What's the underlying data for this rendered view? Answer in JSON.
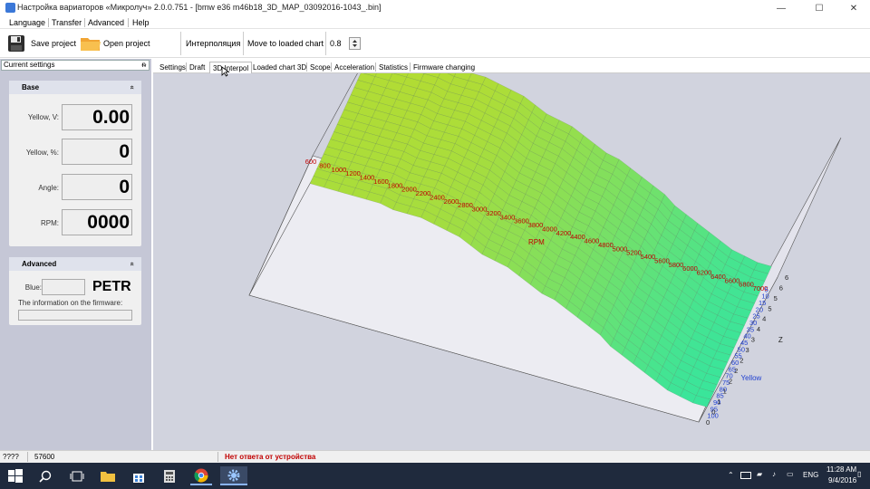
{
  "window": {
    "title": "Настройка вариаторов «Микролуч» 2.0.0.751 - [bmw e36 m46b18_3D_MAP_03092016-1043_.bin]",
    "minimize": "—",
    "maximize": "☐",
    "close": "✕"
  },
  "menu": [
    "Language",
    "Transfer",
    "Advanced",
    "Help"
  ],
  "toolbar": {
    "save": "Save project",
    "open": "Open project",
    "interp": "Интерполяция",
    "move": "Move to loaded chart",
    "value": "0.8"
  },
  "left_panel": {
    "header": "Current settings",
    "pin": "ᵰ",
    "base": {
      "title": "Base",
      "fields": [
        {
          "label": "Yellow, V:",
          "value": "0.00"
        },
        {
          "label": "Yellow, %:",
          "value": "0"
        },
        {
          "label": "Angle:",
          "value": "0"
        },
        {
          "label": "RPM:",
          "value": "0000"
        }
      ]
    },
    "advanced": {
      "title": "Advanced",
      "blue_label": "Blue:",
      "blue_value": "PETR",
      "firmware_label": "The information on the firmware:"
    },
    "chevron": "«"
  },
  "tabs": [
    "Settings",
    "Draft",
    "3D Interpol",
    "Loaded chart 3D",
    "Scope",
    "Acceleration",
    "Statistics",
    "Firmware changing"
  ],
  "active_tab": "3D Interpol",
  "chart_data": {
    "type": "surface3d",
    "xlabel": "RPM",
    "ylabel": "Yellow",
    "zlabel": "Z",
    "rpm": [
      600,
      800,
      1000,
      1200,
      1400,
      1600,
      1800,
      2000,
      2200,
      2400,
      2600,
      2800,
      3000,
      3200,
      3400,
      3600,
      3800,
      4000,
      4200,
      4400,
      4600,
      4800,
      5000,
      5200,
      5400,
      5600,
      5800,
      6000,
      6200,
      6400,
      6600,
      6800,
      7000
    ],
    "rpm_ticks": [
      "600",
      "800",
      "1000",
      "1200",
      "1400",
      "1600",
      "1800",
      "2000",
      "2200",
      "2400",
      "2600",
      "2800",
      "3000",
      "3200",
      "3400",
      "3600",
      "3800",
      "4000",
      "4200",
      "4400",
      "4600",
      "4800",
      "5000",
      "5200",
      "5400",
      "5600",
      "5800",
      "6000",
      "6200",
      "6400",
      "6600",
      "6800",
      "7000"
    ],
    "yellow": [
      5,
      10,
      15,
      20,
      25,
      30,
      35,
      40,
      45,
      50,
      55,
      60,
      65,
      70,
      75,
      80,
      85,
      90,
      95,
      100
    ],
    "yellow_ticks": [
      "5",
      "10",
      "15",
      "20",
      "25",
      "30",
      "35",
      "40",
      "45",
      "50",
      "55",
      "60",
      "65",
      "70",
      "75",
      "80",
      "85",
      "90",
      "95",
      "100"
    ],
    "z_ticks": [
      "0",
      "0",
      "1",
      "1",
      "2",
      "2",
      "2",
      "3",
      "3",
      "4",
      "4",
      "5",
      "5",
      "6",
      "6"
    ],
    "zlim": [
      0,
      6
    ],
    "z_approx_by_rpm": [
      4.8,
      4.8,
      4.8,
      4.8,
      4.8,
      4.8,
      4.7,
      4.7,
      4.7,
      4.6,
      4.5,
      4.4,
      4.2,
      4.0,
      3.9,
      3.8,
      3.6,
      3.4,
      3.2,
      3.1,
      2.9,
      2.7,
      2.5,
      2.3,
      2.0,
      1.8,
      1.6,
      1.4,
      1.2,
      1.0,
      0.9,
      0.8,
      0.8
    ]
  },
  "status": {
    "left": "????",
    "value": "57600",
    "message": "Нет ответа от устройства"
  },
  "taskbar": {
    "lang": "ENG",
    "time": "11:28 AM",
    "date": "9/4/2016"
  }
}
